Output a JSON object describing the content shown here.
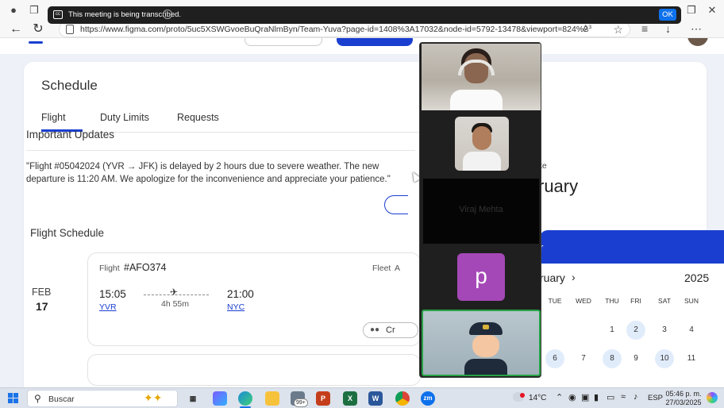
{
  "notification": {
    "text": "This meeting is being transcribed.",
    "ok_label": "OK",
    "cc_icon": "closed-caption-icon",
    "info_icon": "info-icon"
  },
  "browser": {
    "url": "https://www.figma.com/proto/5uc5XSWGvoeBuQraNlmByn/Team-Yuva?page-id=1408%3A17032&node-id=5792-13478&viewport=824%2C115%2C0...",
    "read_aloud": "A³"
  },
  "page": {
    "schedule_title": "Schedule",
    "tabs": [
      {
        "label": "Flight"
      },
      {
        "label": "Duty Limits"
      },
      {
        "label": "Requests"
      }
    ],
    "updates": {
      "title": "Important Updates",
      "text": "\"Flight #05042024  (YVR → JFK) is delayed by 2 hours due to severe weather. The new departure is 11:20 AM. We apologize for the inconvenience and appreciate your patience.\""
    },
    "flight_schedule": {
      "title": "Flight Schedule",
      "date_month": "FEB",
      "date_day": "17",
      "flight_label": "Flight",
      "flight_number": "#AFO374",
      "fleet_label": "Fleet",
      "fleet_value": "A",
      "departure_time": "15:05",
      "departure_code": "YVR",
      "duration": "4h 55m",
      "arrival_time": "21:00",
      "arrival_code": "NYC",
      "crew_label": "Cr"
    },
    "right_panel": {
      "label": "te",
      "month": "ruary"
    },
    "calendar": {
      "header_text": "r",
      "month": "ruary",
      "year": "2025",
      "days_of_week": [
        "TUE",
        "WED",
        "THU",
        "FRI",
        "SAT",
        "SUN"
      ],
      "week1": [
        "1",
        "2",
        "3",
        "4"
      ],
      "week2": [
        "6",
        "7",
        "8",
        "9",
        "10",
        "11"
      ],
      "highlighted": [
        "2",
        "6",
        "8",
        "10"
      ]
    }
  },
  "zoom": {
    "participants": [
      {
        "type": "video"
      },
      {
        "type": "video"
      },
      {
        "type": "name",
        "name": "Viraj Mehta"
      },
      {
        "type": "avatar",
        "initial": "p",
        "color": "#a548b7"
      },
      {
        "type": "avatar-emoji",
        "active": true
      }
    ]
  },
  "taskbar": {
    "search_label": "Buscar",
    "badge": "99+",
    "temperature": "14°C",
    "language": "ESP",
    "time": "05:46 p. m.",
    "date": "27/03/2025"
  },
  "colors": {
    "primary": "#1a3fd0",
    "zoom_bg": "#1f1f1f",
    "active_speaker": "#25a244",
    "ok_button": "#0e71eb"
  }
}
